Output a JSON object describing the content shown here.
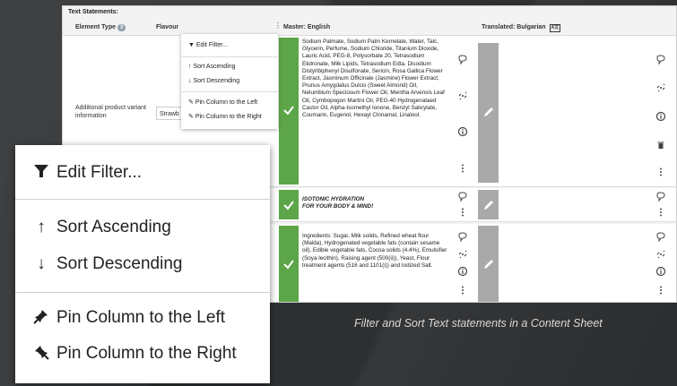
{
  "sheet": {
    "title": "Text Statements:",
    "columns": {
      "element_type": "Element Type",
      "element_type_badge": "3",
      "flavour": "Flavour",
      "master": "Master: English",
      "translated": "Translated: Bulgarian",
      "translated_icon": "A文"
    }
  },
  "rows": [
    {
      "element_type": "Additional product variant information",
      "flavour_value": "Strawb",
      "master_text": "Sodium Palmate, Sodium Palm Kernelate, Water, Talc, Glycerin, Perfume, Sodium Chloride, Titanium Dioxide, Lauric Acid, PEG-8, Polysorbate 20, Tetrasodium Etidronate, Milk Lipids, Tetrasodium Edta, Disodium Distyrlbiphenyl Disulfonate, Sericin, Rosa Gallica Flower Extract, Jasminum Officinale (Jasmine) Flower Extract, Prunus Amygdalus Dulcis (Sweet Almond) Oil, Nelumbium Speciosum Flower Oil, Mentha Arvensis Leaf Oil, Cymbopogon Martini Oil, PEG-40 Hydrogenataed Castor Oil, Alpha-Isomethyl Ionone, Benzyl Salicylate, Coumarin, Eugenol, Hexayl Clnnamal, Linalool."
    },
    {
      "master_line1": "ISOTONIC HYDRATION",
      "master_line2": "FOR YOUR BODY & MIND!"
    },
    {
      "master_text": "Ingredients: Sugar, Milk solids, Refined wheat flour (Maida), Hydrogenated vegetable fats (contain sesame oil), Edible vegetable fats, Cocoa solids (4.4%), Emulsifier (Soya lecithin), Raising agent (500(ii)), Yeast, Flour treatment agents (516 and 1101(i)) and Iodized Salt."
    }
  ],
  "menu": {
    "edit_filter": "Edit Filter...",
    "sort_asc": "Sort Ascending",
    "sort_desc": "Sort Descending",
    "pin_left": "Pin Column to the Left",
    "pin_right": "Pin Column to the Right"
  },
  "caption": "Filter and Sort Text statements in a Content Sheet",
  "colors": {
    "green": "#5ca548",
    "grey_bar": "#a9a9a9",
    "background": "#3a3c3e"
  }
}
